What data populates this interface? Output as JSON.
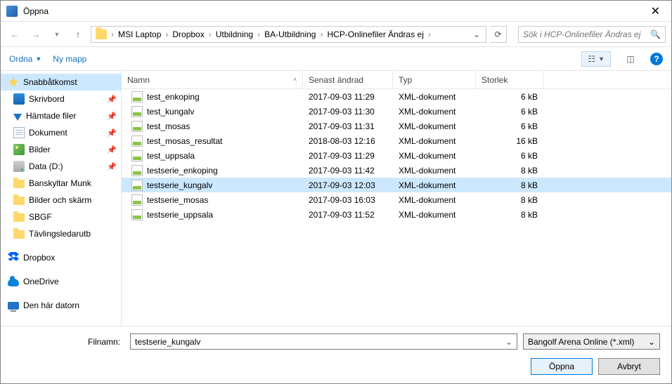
{
  "window": {
    "title": "Öppna"
  },
  "nav": {
    "breadcrumb": [
      "MSI Laptop",
      "Dropbox",
      "Utbildning",
      "BA-Utbildning",
      "HCP-Onlinefiler Ändras ej"
    ],
    "search_placeholder": "Sök i HCP-Onlinefiler Ändras ej"
  },
  "toolbar": {
    "organize": "Ordna",
    "new_folder": "Ny mapp"
  },
  "sidebar": {
    "quick_access": "Snabbåtkomst",
    "items": [
      {
        "label": "Skrivbord",
        "pinned": true,
        "icon": "ic-desk"
      },
      {
        "label": "Hämtade filer",
        "pinned": true,
        "icon": "ic-down"
      },
      {
        "label": "Dokument",
        "pinned": true,
        "icon": "ic-doc"
      },
      {
        "label": "Bilder",
        "pinned": true,
        "icon": "ic-pic"
      },
      {
        "label": "Data (D:)",
        "pinned": true,
        "icon": "ic-drive"
      },
      {
        "label": "Banskyltar Munk",
        "pinned": false,
        "icon": "ic-folder"
      },
      {
        "label": "Bilder och skärm",
        "pinned": false,
        "icon": "ic-folder"
      },
      {
        "label": "SBGF",
        "pinned": false,
        "icon": "ic-folder"
      },
      {
        "label": "Tävlingsledarutb",
        "pinned": false,
        "icon": "ic-folder"
      }
    ],
    "dropbox": "Dropbox",
    "onedrive": "OneDrive",
    "this_pc": "Den här datorn"
  },
  "columns": {
    "name": "Namn",
    "modified": "Senast ändrad",
    "type": "Typ",
    "size": "Storlek"
  },
  "files": [
    {
      "name": "test_enkoping",
      "modified": "2017-09-03 11:29",
      "type": "XML-dokument",
      "size": "6 kB",
      "selected": false
    },
    {
      "name": "test_kungalv",
      "modified": "2017-09-03 11:30",
      "type": "XML-dokument",
      "size": "6 kB",
      "selected": false
    },
    {
      "name": "test_mosas",
      "modified": "2017-09-03 11:31",
      "type": "XML-dokument",
      "size": "6 kB",
      "selected": false
    },
    {
      "name": "test_mosas_resultat",
      "modified": "2018-08-03 12:16",
      "type": "XML-dokument",
      "size": "16 kB",
      "selected": false
    },
    {
      "name": "test_uppsala",
      "modified": "2017-09-03 11:29",
      "type": "XML-dokument",
      "size": "6 kB",
      "selected": false
    },
    {
      "name": "testserie_enkoping",
      "modified": "2017-09-03 11:42",
      "type": "XML-dokument",
      "size": "8 kB",
      "selected": false
    },
    {
      "name": "testserie_kungalv",
      "modified": "2017-09-03 12:03",
      "type": "XML-dokument",
      "size": "8 kB",
      "selected": true
    },
    {
      "name": "testserie_mosas",
      "modified": "2017-09-03 16:03",
      "type": "XML-dokument",
      "size": "8 kB",
      "selected": false
    },
    {
      "name": "testserie_uppsala",
      "modified": "2017-09-03 11:52",
      "type": "XML-dokument",
      "size": "8 kB",
      "selected": false
    }
  ],
  "footer": {
    "filename_label": "Filnamn:",
    "filename_value": "testserie_kungalv",
    "filetype": "Bangolf Arena Online (*.xml)",
    "open": "Öppna",
    "cancel": "Avbryt"
  }
}
